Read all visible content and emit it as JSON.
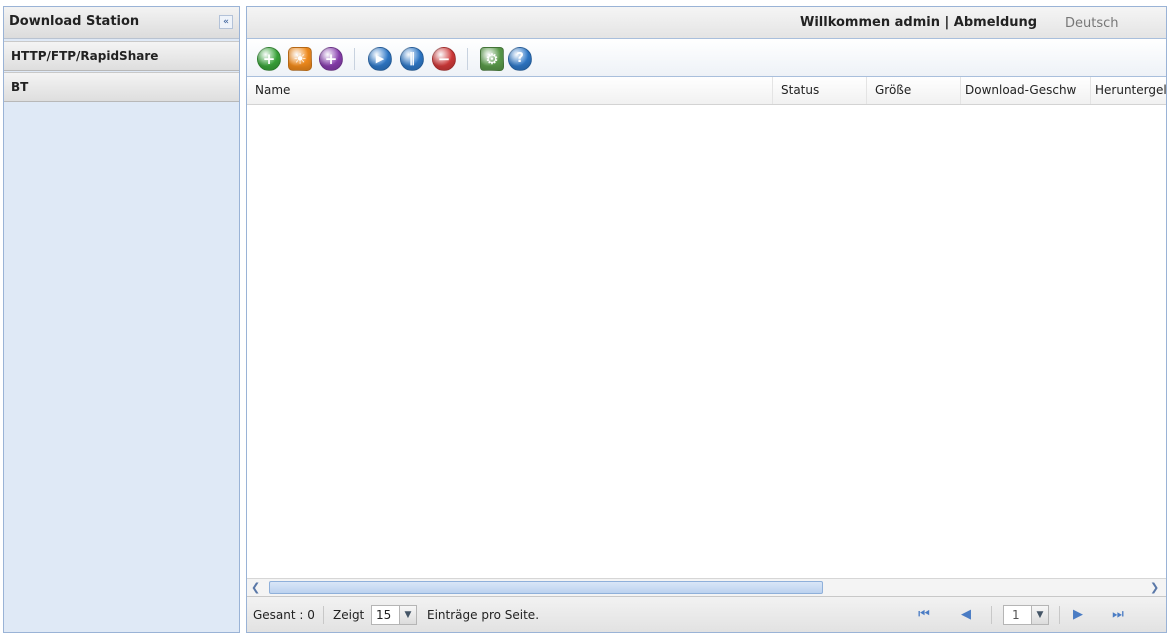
{
  "sidebar": {
    "title": "Download Station",
    "collapse_icon": "«",
    "items": [
      {
        "label": "HTTP/FTP/RapidShare"
      },
      {
        "label": "BT"
      }
    ]
  },
  "header": {
    "welcome": "Willkommen admin",
    "separator": "|",
    "logout": "Abmeldung",
    "language": "Deutsch"
  },
  "toolbar": {
    "buttons": [
      {
        "name": "add-icon",
        "glyph": "+",
        "color": "#3aa63a"
      },
      {
        "name": "rss-icon",
        "glyph": "☀",
        "color": "#f08a1c"
      },
      {
        "name": "add-purple-icon",
        "glyph": "+",
        "color": "#8a3fb0"
      },
      {
        "name": "resume-icon",
        "glyph": "▶",
        "color": "#2f79c9"
      },
      {
        "name": "pause-icon",
        "glyph": "‖",
        "color": "#2f79c9"
      },
      {
        "name": "stop-icon",
        "glyph": "−",
        "color": "#d23a3a"
      },
      {
        "name": "settings-icon",
        "glyph": "⚙",
        "color": "#5a9a4a"
      },
      {
        "name": "help-icon",
        "glyph": "?",
        "color": "#2f79c9"
      }
    ]
  },
  "grid": {
    "columns": [
      "Name",
      "Status",
      "Größe",
      "Download-Geschw",
      "Heruntergela"
    ]
  },
  "scrollbar": {
    "left_arrow": "❮",
    "right_arrow": "❯"
  },
  "pager": {
    "total_label": "Gesant : 0",
    "show_label": "Zeigt",
    "page_size": "15",
    "per_page_label": "Einträge pro Seite.",
    "current_page": "1",
    "first_icon": "⏮",
    "prev_icon": "◀",
    "next_icon": "▶",
    "last_icon": "⏭",
    "dropdown_arrow": "▼"
  }
}
